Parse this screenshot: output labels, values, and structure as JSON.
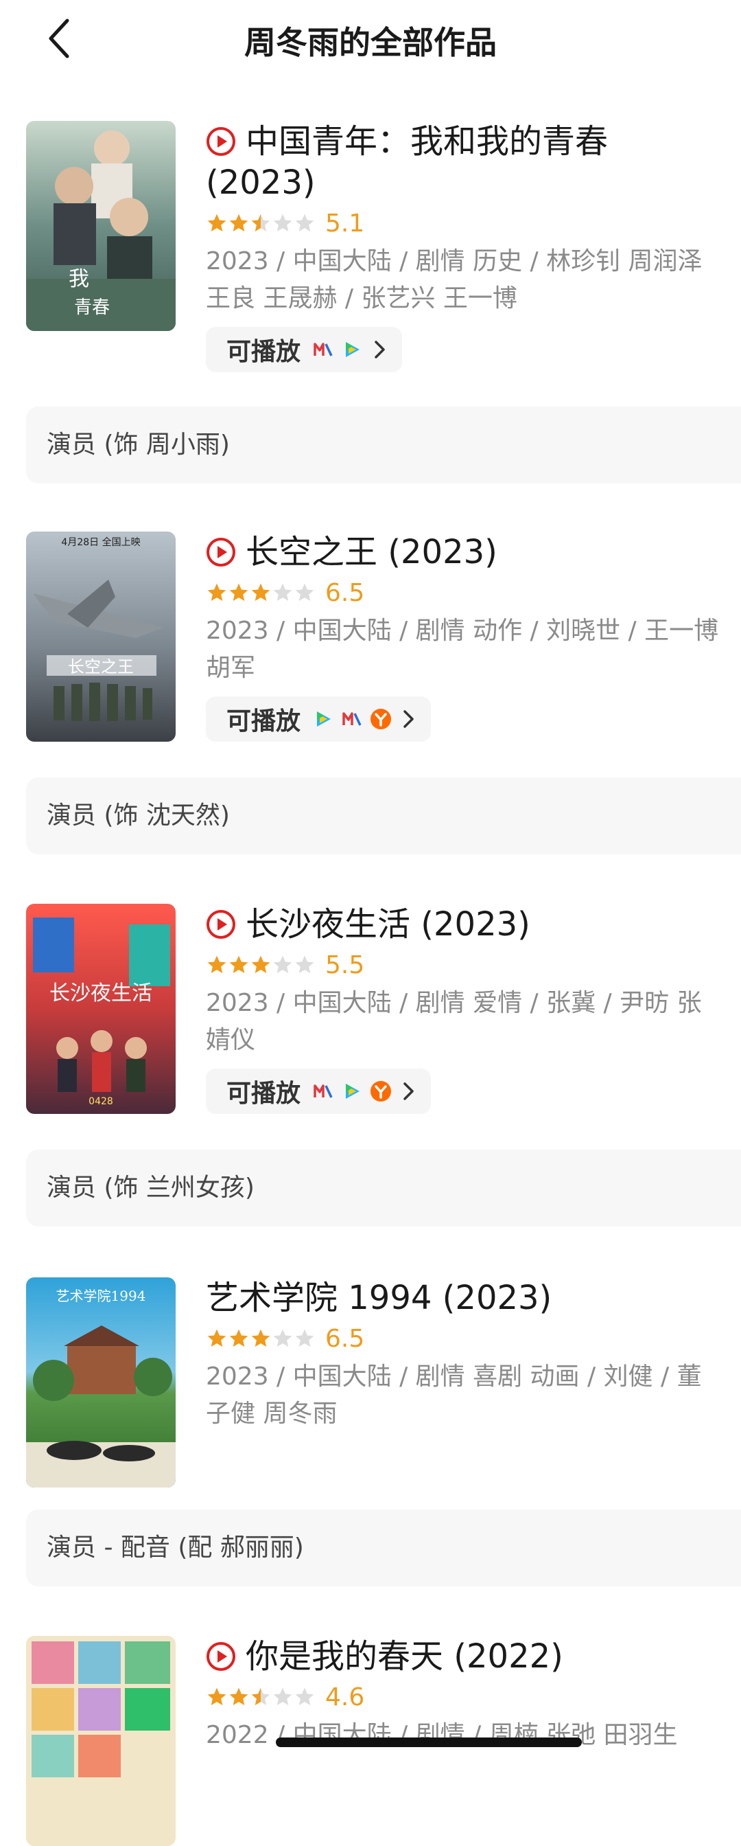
{
  "header": {
    "title": "周冬雨的全部作品",
    "back_icon": "chevron-left-icon"
  },
  "colors": {
    "accent_red": "#e02020",
    "rating_orange": "#f09b1b",
    "meta_gray": "#8a8a8a",
    "role_bg": "#f7f7f7"
  },
  "works": [
    {
      "title": "中国青年：我和我的青春 (2023)",
      "has_play_icon": true,
      "rating": 5.1,
      "rating_text": "5.1",
      "stars": 2.5,
      "meta": "2023 / 中国大陆 / 剧情 历史 / 林珍钊 周润泽 王良 王晟赫 / 张艺兴 王一博",
      "playable_label": "可播放",
      "platforms": [
        "mango-tv-icon",
        "tencent-video-icon"
      ],
      "role": "演员 (饰 周小雨)"
    },
    {
      "title": "长空之王 (2023)",
      "has_play_icon": true,
      "rating": 6.5,
      "rating_text": "6.5",
      "stars": 3,
      "meta": "2023 / 中国大陆 / 剧情 动作 / 刘晓世 / 王一博 胡军",
      "playable_label": "可播放",
      "platforms": [
        "tencent-video-icon",
        "mango-tv-icon",
        "youku-icon"
      ],
      "role": "演员 (饰 沈天然)"
    },
    {
      "title": "长沙夜生活 (2023)",
      "has_play_icon": true,
      "rating": 5.5,
      "rating_text": "5.5",
      "stars": 3,
      "meta": "2023 / 中国大陆 / 剧情 爱情 / 张冀 / 尹昉 张婧仪",
      "playable_label": "可播放",
      "platforms": [
        "mango-tv-icon",
        "tencent-video-icon",
        "youku-icon"
      ],
      "role": "演员 (饰 兰州女孩)"
    },
    {
      "title": "艺术学院 1994 (2023)",
      "has_play_icon": false,
      "rating": 6.5,
      "rating_text": "6.5",
      "stars": 3,
      "meta": "2023 / 中国大陆 / 剧情 喜剧 动画 / 刘健 / 董子健 周冬雨",
      "role": "演员 - 配音 (配 郝丽丽)"
    },
    {
      "title": "你是我的春天 (2022)",
      "has_play_icon": true,
      "rating": 4.6,
      "rating_text": "4.6",
      "stars": 2.5,
      "meta": "2022 / 中国大陆 / 剧情 / 周楠 张弛 田羽生"
    }
  ]
}
